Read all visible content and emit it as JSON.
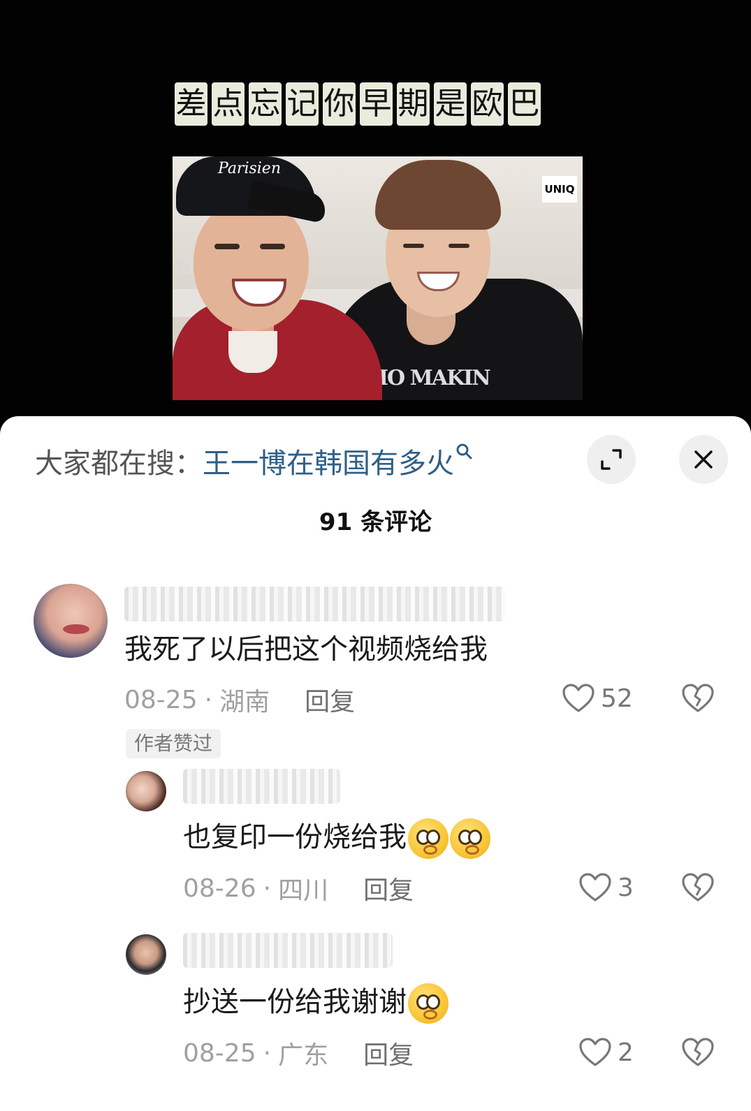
{
  "video": {
    "caption_chars": [
      "差",
      "点",
      "忘",
      "记",
      "你",
      "早",
      "期",
      "是",
      "欧",
      "巴"
    ],
    "cap_text": "Parisien",
    "shirt_text": "IO MAKIN",
    "watermark": "UNIQ"
  },
  "header": {
    "search_prefix": "大家都在搜：",
    "search_term": "王一博在韩国有多火",
    "comment_count": "91 条评论"
  },
  "comments": [
    {
      "text": "我死了以后把这个视频烧给我",
      "date": "08-25",
      "location": "湖南",
      "reply_label": "回复",
      "likes": "52",
      "badge": "作者赞过"
    },
    {
      "text": "也复印一份烧给我",
      "emoji": [
        "pleading-face-icon",
        "pleading-face-icon"
      ],
      "date": "08-26",
      "location": "四川",
      "reply_label": "回复",
      "likes": "3"
    },
    {
      "text": "抄送一份给我谢谢",
      "emoji": [
        "crying-pleading-face-icon"
      ],
      "date": "08-25",
      "location": "广东",
      "reply_label": "回复",
      "likes": "2"
    }
  ],
  "meta_separator": "·"
}
